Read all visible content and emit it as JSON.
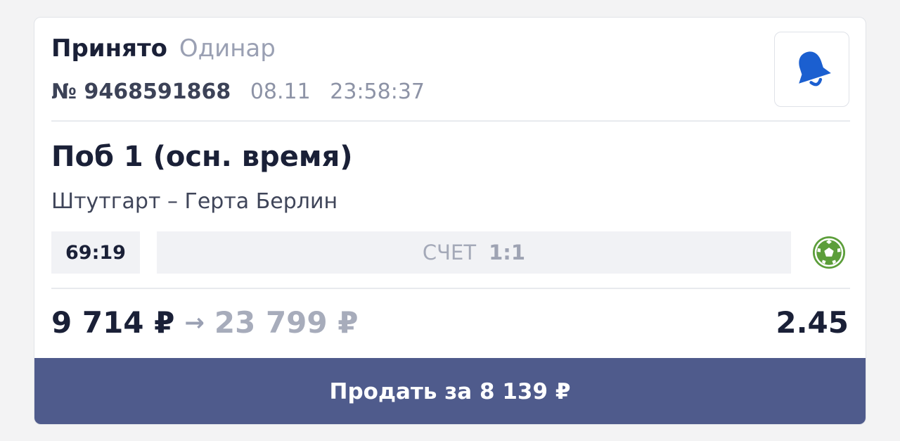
{
  "bet": {
    "status": "Принято",
    "type": "Одинар",
    "number": "№ 9468591868",
    "date": "08.11",
    "time": "23:58:37"
  },
  "event": {
    "market": "Поб 1 (осн. время)",
    "teams": "Штутгарт – Герта Берлин",
    "match_time": "69:19",
    "score_label": "СЧЕТ",
    "score_value": "1:1",
    "sport_icon": "soccer-ball-icon"
  },
  "amounts": {
    "stake": "9 714 ₽",
    "arrow": "→",
    "payout": "23 799 ₽",
    "odds": "2.45"
  },
  "actions": {
    "sell_label": "Продать за 8 139 ₽",
    "bell_icon": "bell-icon"
  },
  "colors": {
    "accent_blue": "#1b5fd0",
    "sell_button": "#4f5b8c",
    "soccer_green": "#5c9e3a"
  }
}
